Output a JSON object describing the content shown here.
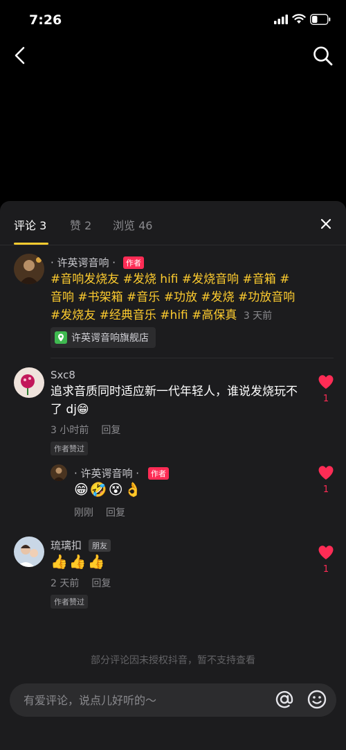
{
  "status_bar": {
    "time": "7:26"
  },
  "tabs": [
    {
      "label": "评论 3",
      "active": true
    },
    {
      "label": "赞 2",
      "active": false
    },
    {
      "label": "浏览 46",
      "active": false
    }
  ],
  "comments": [
    {
      "name": "· 许英谔音响 ·",
      "badge": "作者",
      "text": "#音响发烧友 #发烧 hifi #发烧音响 #音箱 #音响 #书架箱 #音乐 #功放 #发烧 #功放音响 #发烧友 #经典音乐 #hifi #高保真",
      "time": "3 天前",
      "store": "许英谔音响旗舰店"
    },
    {
      "name": "Sxc8",
      "text": "追求音质同时适应新一代年轻人，谁说发烧玩不了 dj😁",
      "time": "3 小时前",
      "reply": "回复",
      "liked_by_author": "作者赞过",
      "likes": "1",
      "replies": [
        {
          "name": "· 许英谔音响 ·",
          "badge": "作者",
          "emojis": "😁🤣😵👌",
          "time": "刚刚",
          "reply": "回复",
          "likes": "1"
        }
      ]
    },
    {
      "name": "琉璃扣",
      "badge": "朋友",
      "emojis": "👍👍👍",
      "time": "2 天前",
      "reply": "回复",
      "liked_by_author": "作者赞过",
      "likes": "1"
    }
  ],
  "notice": "部分评论因未授权抖音，暂不支持查看",
  "input": {
    "placeholder": "有爱评论，说点儿好听的～"
  },
  "colors": {
    "accent": "#fecc2f",
    "like": "#fe2c55",
    "sheet_bg": "#1c1c1e"
  }
}
